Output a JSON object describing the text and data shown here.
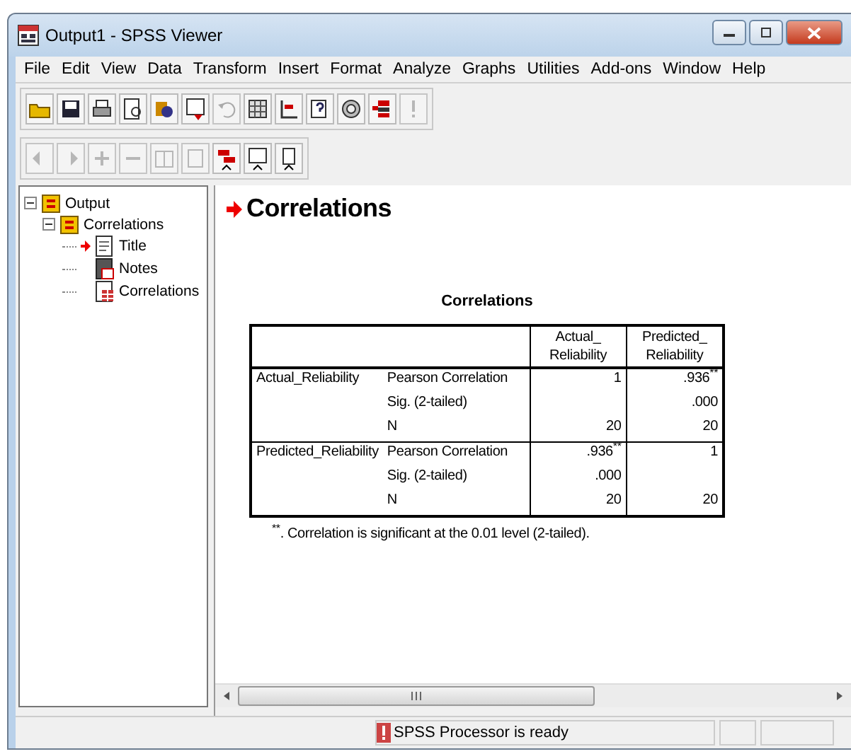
{
  "window": {
    "title": "Output1 - SPSS Viewer"
  },
  "menu": [
    "File",
    "Edit",
    "View",
    "Data",
    "Transform",
    "Insert",
    "Format",
    "Analyze",
    "Graphs",
    "Utilities",
    "Add-ons",
    "Window",
    "Help"
  ],
  "outline": [
    {
      "label": "Output",
      "kind": "book",
      "expanded": true,
      "children": [
        {
          "label": "Correlations",
          "kind": "book",
          "expanded": true,
          "children": [
            {
              "label": "Title",
              "kind": "title",
              "current": true
            },
            {
              "label": "Notes",
              "kind": "notes",
              "current": false
            },
            {
              "label": "Correlations",
              "kind": "table",
              "current": false
            }
          ]
        }
      ]
    }
  ],
  "heading": {
    "text": "Correlations",
    "current": true
  },
  "table": {
    "title": "Correlations",
    "columns": [
      "Actual_ Reliability",
      "Predicted_ Reliability"
    ],
    "groups": [
      {
        "label": "Actual_Reliability",
        "rows": [
          {
            "stat": "Pearson Correlation",
            "cells": [
              {
                "value": "1"
              },
              {
                "value": ".936",
                "mark": "**"
              }
            ]
          },
          {
            "stat": "Sig. (2-tailed)",
            "cells": [
              {},
              {
                "value": ".000"
              }
            ]
          },
          {
            "stat": "N",
            "cells": [
              {
                "value": "20"
              },
              {
                "value": "20"
              }
            ]
          }
        ]
      },
      {
        "label": "Predicted_Reliability",
        "rows": [
          {
            "stat": "Pearson Correlation",
            "cells": [
              {
                "value": ".936",
                "mark": "**"
              },
              {
                "value": "1"
              }
            ]
          },
          {
            "stat": "Sig. (2-tailed)",
            "cells": [
              {
                "value": ".000"
              },
              {}
            ]
          },
          {
            "stat": "N",
            "cells": [
              {
                "value": "20"
              },
              {
                "value": "20"
              }
            ]
          }
        ]
      }
    ],
    "footnote": {
      "mark": "**",
      "text": ". Correlation is significant at the 0.01 level (2-tailed)."
    }
  },
  "status_bar": {
    "text": "SPSS Processor  is ready"
  }
}
